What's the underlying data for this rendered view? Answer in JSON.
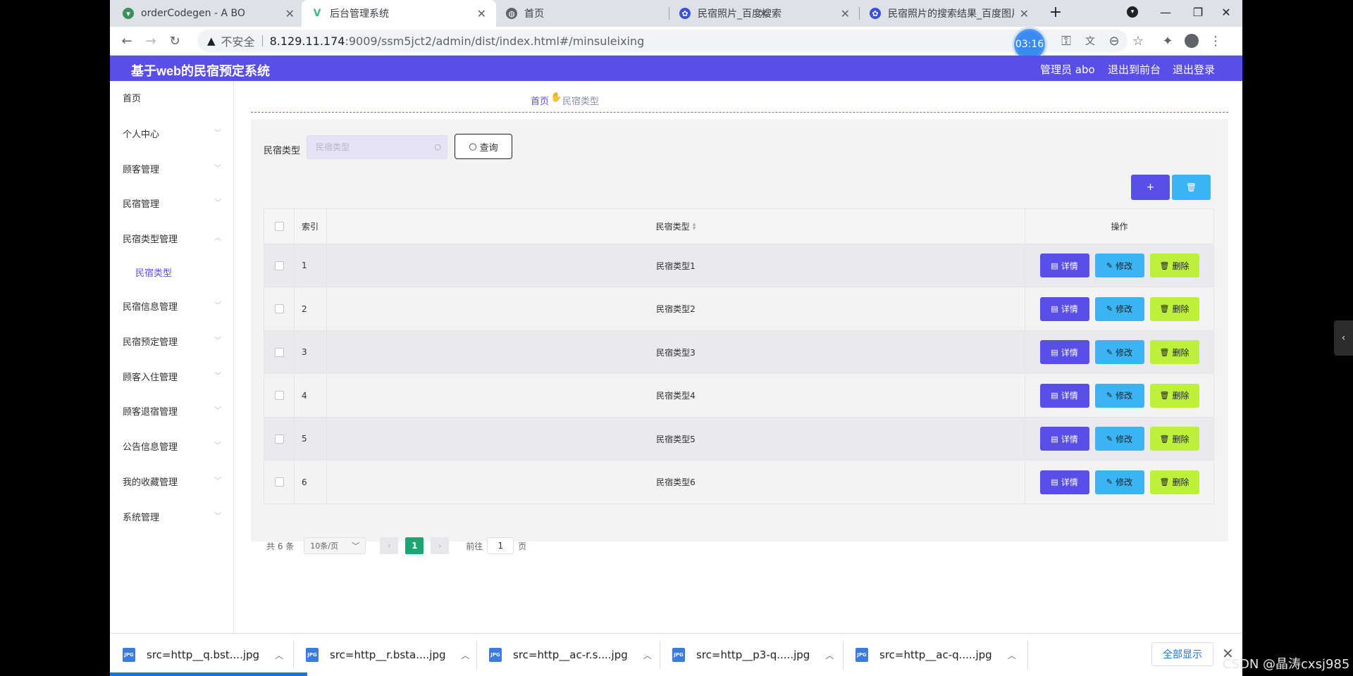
{
  "browser": {
    "tabs": [
      {
        "title": "orderCodegen - A BO",
        "icon": "vue-icon",
        "icon_color": "#3a8f5c"
      },
      {
        "title": "后台管理系统",
        "icon": "vue-icon",
        "icon_color": "#41b883"
      },
      {
        "title": "首页",
        "icon": "globe-icon",
        "icon_color": "#5f6368"
      },
      {
        "title": "民宿照片_百度搜索",
        "icon": "baidu-paw-icon",
        "icon_color": "#3b4fe0"
      },
      {
        "title": "民宿照片的搜索结果_百度图片搜",
        "icon": "baidu-paw-icon",
        "icon_color": "#3b4fe0"
      }
    ],
    "address": {
      "security_label": "不安全",
      "host": "8.129.11.174",
      "path": ":9009/ssm5jct2/admin/dist/index.html#/minsuleixing"
    },
    "timer": "03:16"
  },
  "app": {
    "title": "基于web的民宿预定系统",
    "header_links": {
      "admin": "管理员 abo",
      "front": "退出到前台",
      "logout": "退出登录"
    },
    "accent": "#5a4ee8"
  },
  "sidebar": {
    "items": [
      {
        "label": "首页",
        "expandable": false
      },
      {
        "label": "个人中心",
        "expandable": true,
        "expanded": false
      },
      {
        "label": "顾客管理",
        "expandable": true,
        "expanded": false
      },
      {
        "label": "民宿管理",
        "expandable": true,
        "expanded": false
      },
      {
        "label": "民宿类型管理",
        "expandable": true,
        "expanded": true
      },
      {
        "label": "民宿信息管理",
        "expandable": true,
        "expanded": false
      },
      {
        "label": "民宿预定管理",
        "expandable": true,
        "expanded": false
      },
      {
        "label": "顾客入住管理",
        "expandable": true,
        "expanded": false
      },
      {
        "label": "顾客退宿管理",
        "expandable": true,
        "expanded": false
      },
      {
        "label": "公告信息管理",
        "expandable": true,
        "expanded": false
      },
      {
        "label": "我的收藏管理",
        "expandable": true,
        "expanded": false
      },
      {
        "label": "系统管理",
        "expandable": true,
        "expanded": false
      }
    ],
    "subitem": "民宿类型"
  },
  "breadcrumb": {
    "home": "首页",
    "current": "民宿类型"
  },
  "search": {
    "label": "民宿类型",
    "placeholder": "民宿类型",
    "value": "",
    "button": "查询"
  },
  "actions": {
    "add": "+",
    "delete_icon": "trash-icon"
  },
  "table": {
    "headers": {
      "index": "索引",
      "type": "民宿类型",
      "ops": "操作"
    },
    "rows": [
      {
        "index": "1",
        "type": "民宿类型1"
      },
      {
        "index": "2",
        "type": "民宿类型2"
      },
      {
        "index": "3",
        "type": "民宿类型3"
      },
      {
        "index": "4",
        "type": "民宿类型4"
      },
      {
        "index": "5",
        "type": "民宿类型5"
      },
      {
        "index": "6",
        "type": "民宿类型6"
      }
    ],
    "row_buttons": {
      "detail": "详情",
      "edit": "修改",
      "delete": "删除"
    }
  },
  "pagination": {
    "total": "共 6 条",
    "page_size": "10条/页",
    "current": "1",
    "goto_label": "前往",
    "goto_value": "1",
    "page_word": "页"
  },
  "downloads": {
    "items": [
      "src=http__q.bst....jpg",
      "src=http__r.bsta....jpg",
      "src=http__ac-r.s....jpg",
      "src=http__p3-q.....jpg",
      "src=http__ac-q.....jpg"
    ],
    "show_all": "全部显示"
  },
  "watermark": "CSDN @晶涛cxsj985"
}
